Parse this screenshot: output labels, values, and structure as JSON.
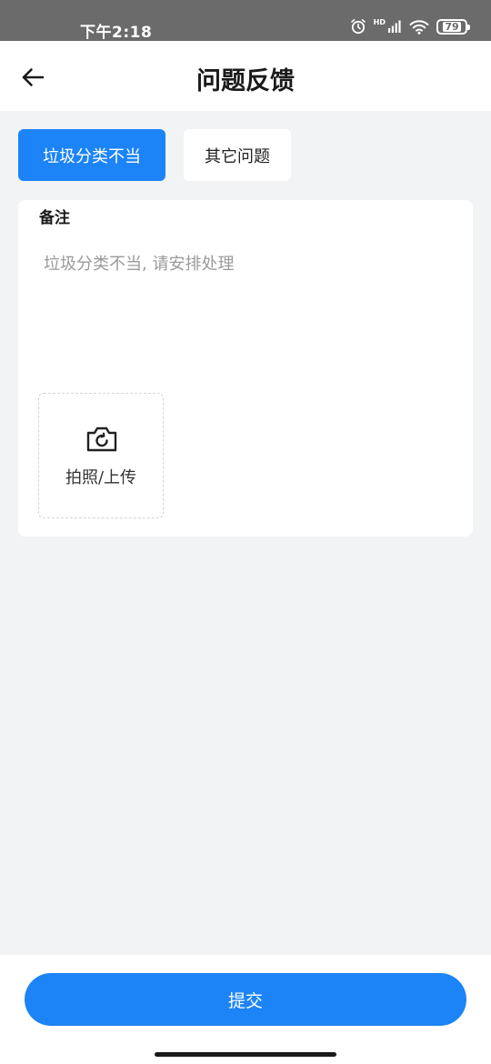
{
  "status_bar": {
    "time": "下午2:18",
    "network": "HD",
    "battery": "79",
    "icons": [
      "alarm-icon",
      "signal-icon",
      "wifi-icon",
      "battery-icon"
    ]
  },
  "header": {
    "title": "问题反馈",
    "back_icon": "arrow-left-icon"
  },
  "tabs": [
    {
      "label": "垃圾分类不当",
      "active": true
    },
    {
      "label": "其它问题",
      "active": false
    }
  ],
  "remark": {
    "label": "备注",
    "value": "",
    "placeholder": "垃圾分类不当, 请安排处理"
  },
  "upload": {
    "label": "拍照/上传",
    "icon": "camera-icon"
  },
  "submit": {
    "label": "提交"
  },
  "colors": {
    "primary": "#1c84f6",
    "background": "#f2f3f5",
    "status_bar": "#6b6b6b"
  }
}
